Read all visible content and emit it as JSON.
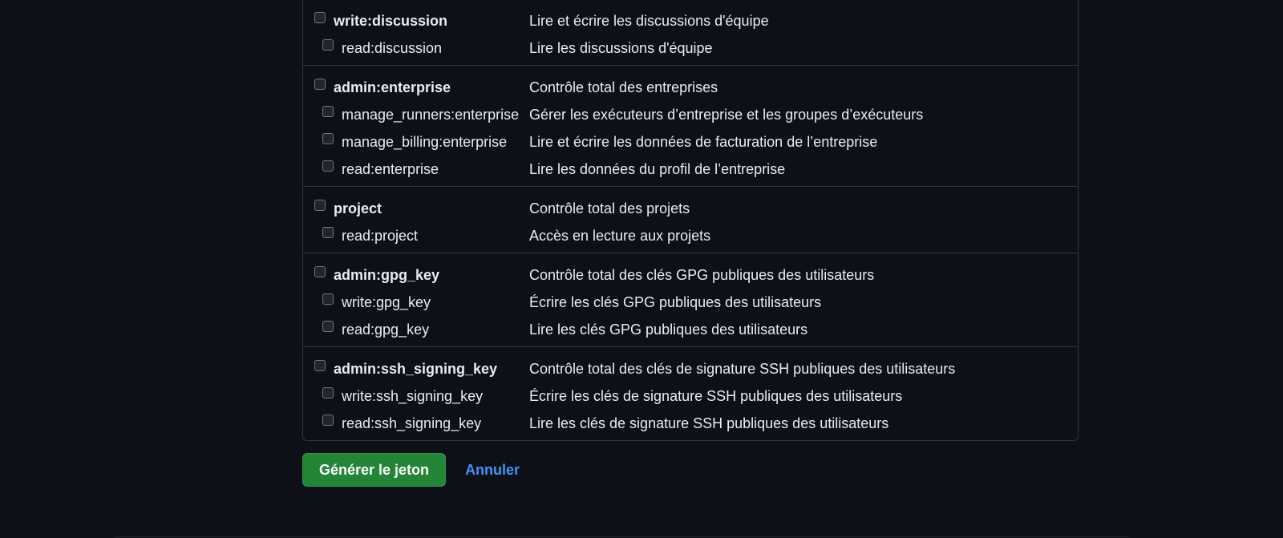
{
  "scope_groups": [
    {
      "parent": {
        "name": "write:discussion",
        "desc": "Lire et écrire les discussions d'équipe"
      },
      "children": [
        {
          "name": "read:discussion",
          "desc": "Lire les discussions d'équipe"
        }
      ]
    },
    {
      "parent": {
        "name": "admin:enterprise",
        "desc": "Contrôle total des entreprises"
      },
      "children": [
        {
          "name": "manage_runners:enterprise",
          "desc": "Gérer les exécuteurs d’entreprise et les groupes d’exécuteurs"
        },
        {
          "name": "manage_billing:enterprise",
          "desc": "Lire et écrire les données de facturation de l’entreprise"
        },
        {
          "name": "read:enterprise",
          "desc": "Lire les données du profil de l’entreprise"
        }
      ]
    },
    {
      "parent": {
        "name": "project",
        "desc": "Contrôle total des projets"
      },
      "children": [
        {
          "name": "read:project",
          "desc": "Accès en lecture aux projets"
        }
      ]
    },
    {
      "parent": {
        "name": "admin:gpg_key",
        "desc": "Contrôle total des clés GPG publiques des utilisateurs"
      },
      "children": [
        {
          "name": "write:gpg_key",
          "desc": "Écrire les clés GPG publiques des utilisateurs"
        },
        {
          "name": "read:gpg_key",
          "desc": "Lire les clés GPG publiques des utilisateurs"
        }
      ]
    },
    {
      "parent": {
        "name": "admin:ssh_signing_key",
        "desc": "Contrôle total des clés de signature SSH publiques des utilisateurs"
      },
      "children": [
        {
          "name": "write:ssh_signing_key",
          "desc": "Écrire les clés de signature SSH publiques des utilisateurs"
        },
        {
          "name": "read:ssh_signing_key",
          "desc": "Lire les clés de signature SSH publiques des utilisateurs"
        }
      ]
    }
  ],
  "actions": {
    "generate_label": "Générer le jeton",
    "cancel_label": "Annuler"
  },
  "colors": {
    "background": "#0d1117",
    "primary_button": "#238636",
    "link": "#4493f8",
    "border": "#30363d"
  }
}
